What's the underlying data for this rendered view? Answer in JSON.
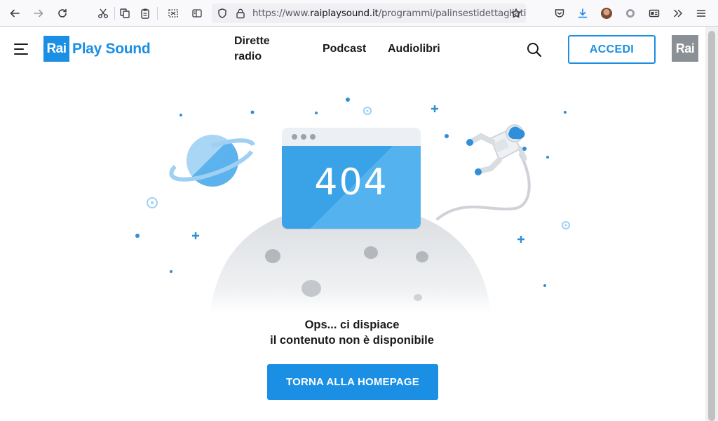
{
  "browser": {
    "url_prefix": "https://www.",
    "url_host": "raiplaysound.it",
    "url_path": "/programmi/palinsestidettagliati"
  },
  "header": {
    "logo_rai": "Rai",
    "logo_rest": "Play Sound",
    "nav": [
      {
        "line1": "Dirette",
        "line2": "radio"
      },
      {
        "label": "Podcast"
      },
      {
        "label": "Audiolibri"
      }
    ],
    "login_label": "ACCEDI",
    "rai_badge": "Rai"
  },
  "error": {
    "code": "404",
    "line1": "Ops... ci dispiace",
    "line2": "il contenuto non è disponibile",
    "button_label": "TORNA ALLA HOMEPAGE"
  },
  "colors": {
    "brand": "#1a8fe3",
    "screen_blue": "#3aa3e8",
    "planet": "#5bb2ec",
    "moon": "#e3e5e8"
  },
  "icons": [
    "back-icon",
    "forward-icon",
    "reload-icon",
    "cut-icon",
    "copy-icon",
    "paste-icon",
    "screenshot-icon",
    "reader-icon",
    "shield-icon",
    "lock-icon",
    "star-icon",
    "pocket-icon",
    "download-icon",
    "extensions-icon",
    "menu-icon",
    "search-icon",
    "hamburger-icon"
  ]
}
